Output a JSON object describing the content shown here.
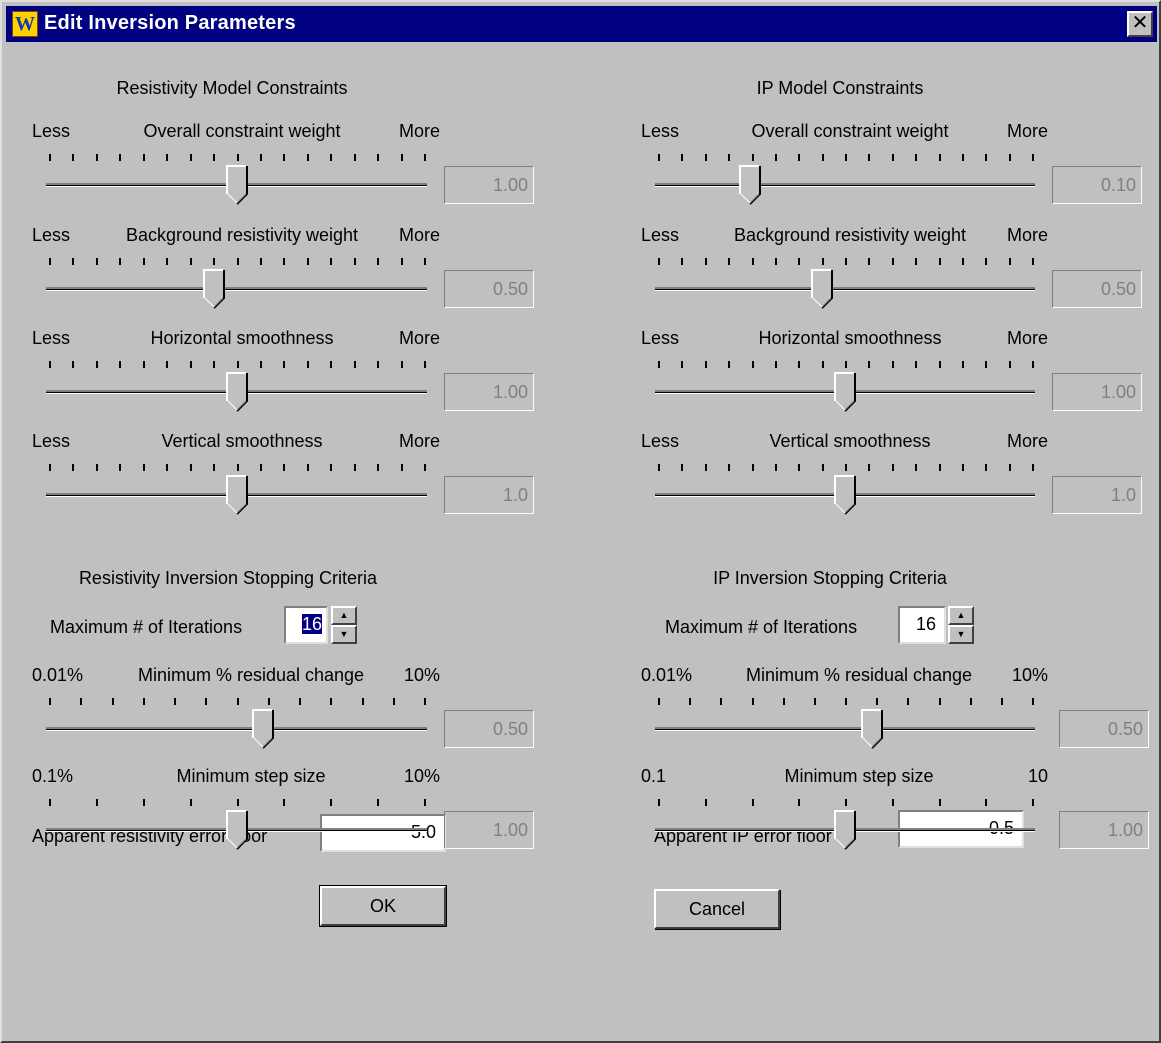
{
  "window": {
    "title": "Edit Inversion Parameters",
    "icon_glyph": "W",
    "close_glyph": "✕"
  },
  "resistivity": {
    "heading": "Resistivity Model Constraints",
    "sliders": [
      {
        "left": "Less",
        "label": "Overall constraint weight",
        "right": "More",
        "value": "1.00",
        "level": 0.5,
        "ticks": 17
      },
      {
        "left": "Less",
        "label": "Background resistivity weight",
        "right": "More",
        "value": "0.50",
        "level": 0.44,
        "ticks": 17
      },
      {
        "left": "Less",
        "label": "Horizontal smoothness",
        "right": "More",
        "value": "1.00",
        "level": 0.5,
        "ticks": 17
      },
      {
        "left": "Less",
        "label": "Vertical smoothness",
        "right": "More",
        "value": "1.0",
        "level": 0.5,
        "ticks": 17
      }
    ],
    "stop_heading": "Resistivity Inversion Stopping Criteria",
    "iterations_label": "Maximum # of Iterations",
    "iterations_value": "16",
    "stop_sliders": [
      {
        "left": "0.01%",
        "label": "Minimum % residual change",
        "right": "10%",
        "value": "0.50",
        "level": 0.57,
        "ticks": 13
      },
      {
        "left": "0.1%",
        "label": "Minimum step size",
        "right": "10%",
        "value": "1.00",
        "level": 0.5,
        "ticks": 9
      }
    ],
    "floor_label": "Apparent resistivity error floor",
    "floor_value": "5.0"
  },
  "ip": {
    "heading": "IP Model Constraints",
    "sliders": [
      {
        "left": "Less",
        "label": "Overall constraint weight",
        "right": "More",
        "value": "0.10",
        "level": 0.25,
        "ticks": 17
      },
      {
        "left": "Less",
        "label": "Background resistivity weight",
        "right": "More",
        "value": "0.50",
        "level": 0.44,
        "ticks": 17
      },
      {
        "left": "Less",
        "label": "Horizontal smoothness",
        "right": "More",
        "value": "1.00",
        "level": 0.5,
        "ticks": 17
      },
      {
        "left": "Less",
        "label": "Vertical smoothness",
        "right": "More",
        "value": "1.0",
        "level": 0.5,
        "ticks": 17
      }
    ],
    "stop_heading": "IP Inversion Stopping Criteria",
    "iterations_label": "Maximum # of Iterations",
    "iterations_value": "16",
    "stop_sliders": [
      {
        "left": "0.01%",
        "label": "Minimum % residual change",
        "right": "10%",
        "value": "0.50",
        "level": 0.57,
        "ticks": 13
      },
      {
        "left": "0.1",
        "label": "Minimum step size",
        "right": "10",
        "value": "1.00",
        "level": 0.5,
        "ticks": 9
      }
    ],
    "floor_label": "Apparent IP error floor",
    "floor_value": "0.5"
  },
  "buttons": {
    "ok": "OK",
    "cancel": "Cancel"
  },
  "colors": {
    "face": "#c0c0c0",
    "titlebar": "#000080",
    "disabled_text": "#808080",
    "selection": "#000080"
  }
}
